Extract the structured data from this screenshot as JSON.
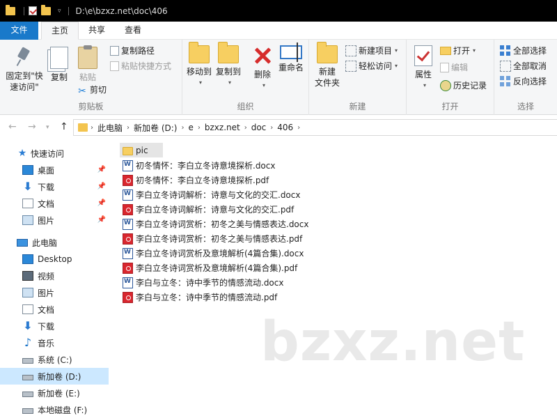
{
  "titlebar": {
    "path": "D:\\e\\bzxz.net\\doc\\406"
  },
  "tabs": [
    "文件",
    "主页",
    "共享",
    "查看"
  ],
  "ribbon": {
    "clipboard": {
      "label": "剪贴板",
      "pin": "固定到\"快\n速访问\"",
      "copy": "复制",
      "paste": "粘贴",
      "copy_path": "复制路径",
      "paste_shortcut": "粘贴快捷方式",
      "cut": "剪切"
    },
    "organize": {
      "label": "组织",
      "move_to": "移动到",
      "copy_to": "复制到",
      "delete": "删除",
      "rename": "重命名"
    },
    "new": {
      "label": "新建",
      "new_folder": "新建\n文件夹",
      "new_item": "新建项目",
      "easy_access": "轻松访问"
    },
    "open": {
      "label": "打开",
      "properties": "属性",
      "open": "打开",
      "edit": "编辑",
      "history": "历史记录"
    },
    "select": {
      "label": "选择",
      "select_all": "全部选择",
      "select_none": "全部取消",
      "invert": "反向选择"
    }
  },
  "breadcrumb": [
    "此电脑",
    "新加卷 (D:)",
    "e",
    "bzxz.net",
    "doc",
    "406"
  ],
  "nav": {
    "quick_access": "快速访问",
    "quick_items": [
      "桌面",
      "下载",
      "文档",
      "图片"
    ],
    "this_pc": "此电脑",
    "pc_items": [
      "Desktop",
      "视频",
      "图片",
      "文档",
      "下载",
      "音乐",
      "系统 (C:)",
      "新加卷 (D:)",
      "新加卷 (E:)",
      "本地磁盘 (F:)"
    ]
  },
  "files": [
    {
      "name": "pic",
      "type": "folder"
    },
    {
      "name": "初冬情怀：李白立冬诗意境探析.docx",
      "type": "word"
    },
    {
      "name": "初冬情怀：李白立冬诗意境探析.pdf",
      "type": "pdf"
    },
    {
      "name": "李白立冬诗词解析：诗意与文化的交汇.docx",
      "type": "word"
    },
    {
      "name": "李白立冬诗词解析：诗意与文化的交汇.pdf",
      "type": "pdf"
    },
    {
      "name": "李白立冬诗词赏析：初冬之美与情感表达.docx",
      "type": "word"
    },
    {
      "name": "李白立冬诗词赏析：初冬之美与情感表达.pdf",
      "type": "pdf"
    },
    {
      "name": "李白立冬诗词赏析及意境解析(4篇合集).docx",
      "type": "word"
    },
    {
      "name": "李白立冬诗词赏析及意境解析(4篇合集).pdf",
      "type": "pdf"
    },
    {
      "name": "李白与立冬：诗中季节的情感流动.docx",
      "type": "word"
    },
    {
      "name": "李白与立冬：诗中季节的情感流动.pdf",
      "type": "pdf"
    }
  ],
  "watermark": "bzxz.net",
  "colors": {
    "file_tab": "#1979ca",
    "selection": "#cce8ff",
    "folder": "#f7cf61"
  }
}
